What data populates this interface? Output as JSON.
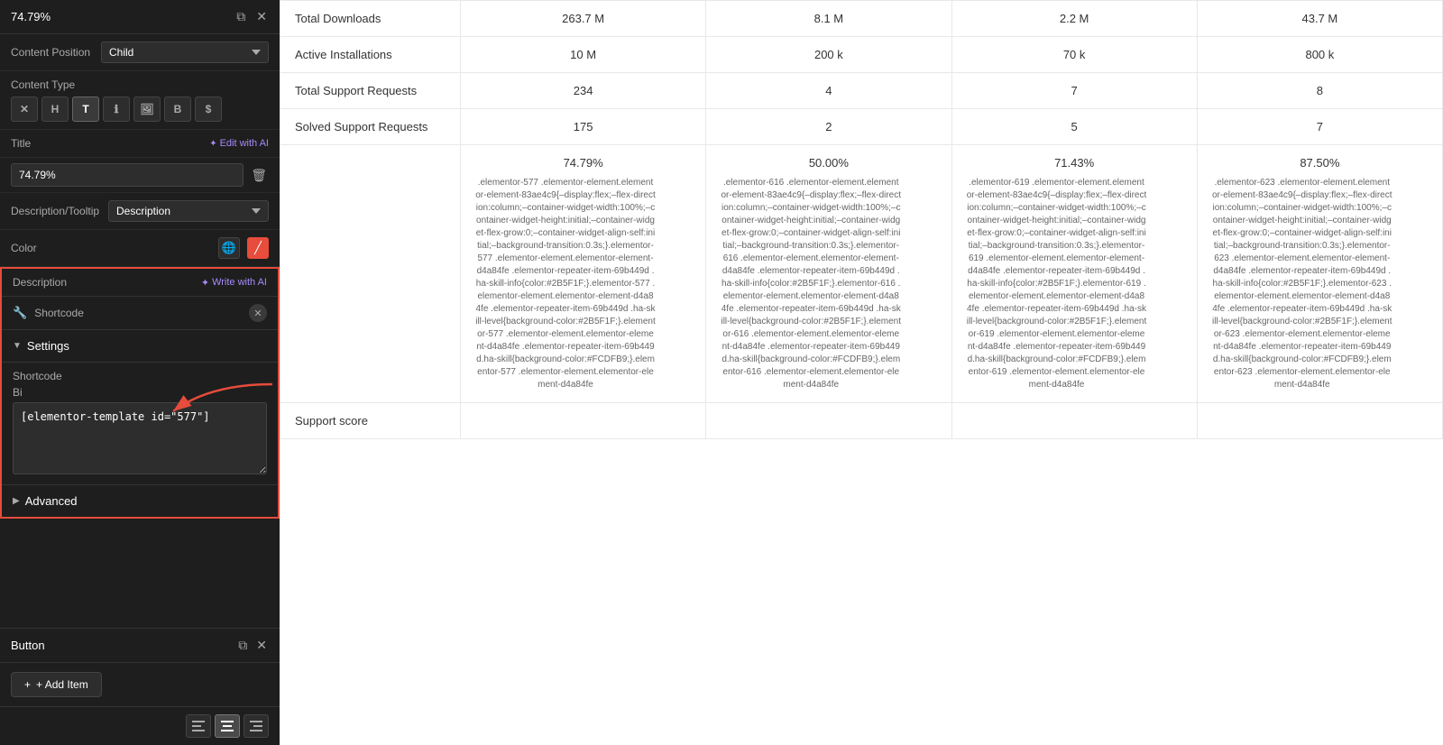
{
  "panel": {
    "top_value": "74.79%",
    "copy_icon": "⧉",
    "close_icon": "✕",
    "content_position_label": "Content Position",
    "content_position_value": "Child",
    "content_type_label": "Content Type",
    "content_type_icons": [
      "✕",
      "H",
      "T",
      "ℹ",
      "🖼",
      "B",
      "$"
    ],
    "title_label": "Title",
    "edit_ai_label": "Edit with AI",
    "title_input_value": "74.79%",
    "delete_icon": "🗑",
    "tooltip_label": "Description/Tooltip",
    "tooltip_value": "Description",
    "color_label": "Color",
    "description_label": "Description",
    "write_ai_label": "Write with AI",
    "shortcode_icon": "🔧",
    "shortcode_label": "Shortcode",
    "clear_icon": "✕",
    "settings_label": "Settings",
    "shortcode_field_label": "Shortcode",
    "shortcode_value": "[elementor-template id=\"577\"]",
    "advanced_label": "Advanced",
    "button_panel_label": "Button",
    "add_item_label": "+ Add Item",
    "alignment_label": "",
    "align_left": "≡",
    "align_center": "≡",
    "align_right": "≡"
  },
  "table": {
    "rows": [
      {
        "label": "Total Downloads",
        "col1": "263.7 M",
        "col2": "8.1 M",
        "col3": "2.2 M",
        "col4": "43.7 M"
      },
      {
        "label": "Active Installations",
        "col1": "10 M",
        "col2": "200 k",
        "col3": "70 k",
        "col4": "800 k"
      },
      {
        "label": "Total Support Requests",
        "col1": "234",
        "col2": "4",
        "col3": "7",
        "col4": "8"
      },
      {
        "label": "Solved Support Requests",
        "col1": "175",
        "col2": "2",
        "col3": "5",
        "col4": "7"
      },
      {
        "label": "",
        "col1": "74.79%",
        "col2": "50.00%",
        "col3": "71.43%",
        "col4": "87.50%"
      }
    ],
    "support_score_label": "Support score",
    "code_col1": ".elementor-577 .elementor-element.elementor-element-83ae4c9{–display:flex;–flex-direction:column;–container-widget-width:100%;–container-widget-height:initial;–container-widget-flex-grow:0;–container-widget-align-self:initial;–background-transition:0.3s;}.elementor-577 .elementor-element.elementor-element-d4a84fe .elementor-repeater-item-69b449d .ha-skill-info{color:#2B5F1F;}.elementor-577 .elementor-element.elementor-element-d4a84fe .elementor-repeater-item-69b449d .ha-skill-level{background-color:#2B5F1F;}.elementor-577 .elementor-element.elementor-element-d4a84fe .elementor-repeater-item-69b449d.ha-skill{background-color:#FCDFB9;}.elementor-577 .elementor-element.elementor-element-d4a84fe",
    "code_col2": ".elementor-616 .elementor-element.elementor-element-83ae4c9{–display:flex;–flex-direction:column;–container-widget-width:100%;–container-widget-height:initial;–container-widget-flex-grow:0;–container-widget-align-self:initial;–background-transition:0.3s;}.elementor-616 .elementor-element.elementor-element-d4a84fe .elementor-repeater-item-69b449d .ha-skill-info{color:#2B5F1F;}.elementor-616 .elementor-element.elementor-element-d4a84fe .elementor-repeater-item-69b449d .ha-skill-level{background-color:#2B5F1F;}.elementor-616 .elementor-element.elementor-element-d4a84fe .elementor-repeater-item-69b449d.ha-skill{background-color:#FCDFB9;}.elementor-616 .elementor-element.elementor-element-d4a84fe",
    "code_col3": ".elementor-619 .elementor-element.elementor-element-83ae4c9{–display:flex;–flex-direction:column;–container-widget-width:100%;–container-widget-height:initial;–container-widget-flex-grow:0;–container-widget-align-self:initial;–background-transition:0.3s;}.elementor-619 .elementor-element.elementor-element-d4a84fe .elementor-repeater-item-69b449d .ha-skill-info{color:#2B5F1F;}.elementor-619 .elementor-element.elementor-element-d4a84fe .elementor-repeater-item-69b449d .ha-skill-level{background-color:#2B5F1F;}.elementor-619 .elementor-element.elementor-element-d4a84fe .elementor-repeater-item-69b449d.ha-skill{background-color:#FCDFB9;}.elementor-619 .elementor-element.elementor-element-d4a84fe",
    "code_col4": ".elementor-623 .elementor-element.elementor-element-83ae4c9{–display:flex;–flex-direction:column;–container-widget-width:100%;–container-widget-height:initial;–container-widget-flex-grow:0;–container-widget-align-self:initial;–background-transition:0.3s;}.elementor-623 .elementor-element.elementor-element-d4a84fe .elementor-repeater-item-69b449d .ha-skill-info{color:#2B5F1F;}.elementor-623 .elementor-element.elementor-element-d4a84fe .elementor-repeater-item-69b449d .ha-skill-level{background-color:#2B5F1F;}.elementor-623 .elementor-element.elementor-element-d4a84fe .elementor-repeater-item-69b449d.ha-skill{background-color:#FCDFB9;}.elementor-623 .elementor-element.elementor-element-d4a84fe"
  }
}
